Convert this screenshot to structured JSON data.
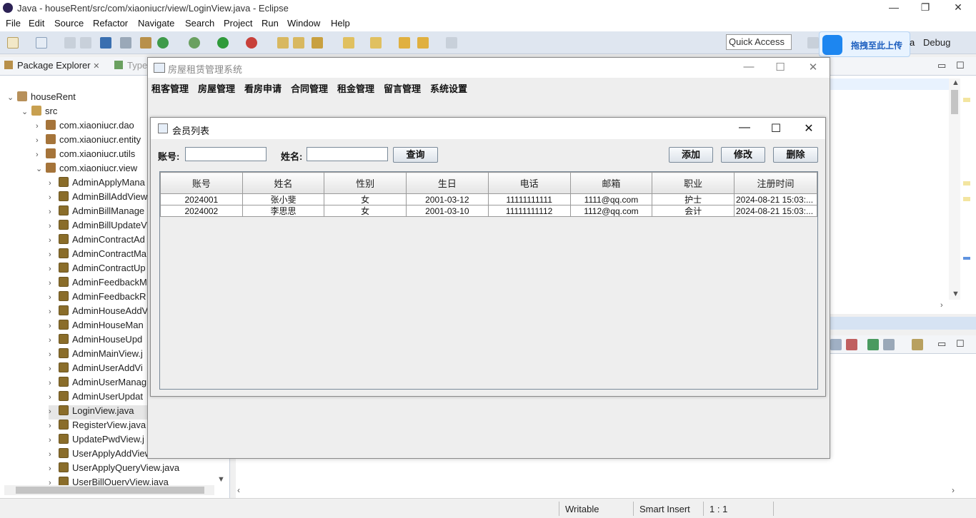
{
  "eclipse": {
    "window_title": "Java - houseRent/src/com/xiaoniucr/view/LoginView.java - Eclipse",
    "menu": [
      "File",
      "Edit",
      "Source",
      "Refactor",
      "Navigate",
      "Search",
      "Project",
      "Run",
      "Window",
      "Help"
    ],
    "quick_access": "Quick Access",
    "upload_label": "拖拽至此上传",
    "debug_label": "Debug",
    "package_explorer_tab": "Package Explorer",
    "type_hierarchy_tab": "Type",
    "tree": [
      {
        "label": "houseRent",
        "icon": "project-icon"
      },
      {
        "label": "src",
        "icon": "source-folder-icon"
      },
      {
        "label": "com.xiaoniucr.dao",
        "icon": "package-icon"
      },
      {
        "label": "com.xiaoniucr.entity",
        "icon": "package-icon"
      },
      {
        "label": "com.xiaoniucr.utils",
        "icon": "package-icon"
      },
      {
        "label": "com.xiaoniucr.view",
        "icon": "package-icon"
      },
      {
        "label": "AdminApplyMana",
        "icon": "java-file-icon"
      },
      {
        "label": "AdminBillAddView",
        "icon": "java-file-icon"
      },
      {
        "label": "AdminBillManage",
        "icon": "java-file-icon"
      },
      {
        "label": "AdminBillUpdateV",
        "icon": "java-file-icon"
      },
      {
        "label": "AdminContractAd",
        "icon": "java-file-icon"
      },
      {
        "label": "AdminContractMa",
        "icon": "java-file-icon"
      },
      {
        "label": "AdminContractUp",
        "icon": "java-file-icon"
      },
      {
        "label": "AdminFeedbackM",
        "icon": "java-file-icon"
      },
      {
        "label": "AdminFeedbackR",
        "icon": "java-file-icon"
      },
      {
        "label": "AdminHouseAddV",
        "icon": "java-file-icon"
      },
      {
        "label": "AdminHouseMan",
        "icon": "java-file-icon"
      },
      {
        "label": "AdminHouseUpd",
        "icon": "java-file-icon"
      },
      {
        "label": "AdminMainView.j",
        "icon": "java-file-icon"
      },
      {
        "label": "AdminUserAddVi",
        "icon": "java-file-icon"
      },
      {
        "label": "AdminUserManag",
        "icon": "java-file-icon"
      },
      {
        "label": "AdminUserUpdat",
        "icon": "java-file-icon"
      },
      {
        "label": "LoginView.java",
        "icon": "java-file-icon"
      },
      {
        "label": "RegisterView.java",
        "icon": "java-file-icon"
      },
      {
        "label": "UpdatePwdView.j",
        "icon": "java-file-icon"
      },
      {
        "label": "UserApplyAddView.java",
        "icon": "java-file-icon"
      },
      {
        "label": "UserApplyQueryView.java",
        "icon": "java-file-icon"
      },
      {
        "label": "UserBillQueryView.java",
        "icon": "java-file-icon"
      }
    ],
    "status": {
      "writable": "Writable",
      "insert_mode": "Smart Insert",
      "position": "1 : 1"
    }
  },
  "app": {
    "title": "房屋租赁管理系统",
    "menu": [
      "租客管理",
      "房屋管理",
      "看房申请",
      "合同管理",
      "租金管理",
      "留言管理",
      "系统设置"
    ]
  },
  "member_list": {
    "title": "会员列表",
    "account_label": "账号:",
    "name_label": "姓名:",
    "account_value": "",
    "name_value": "",
    "query_button": "查询",
    "add_button": "添加",
    "edit_button": "修改",
    "delete_button": "删除",
    "columns": [
      "账号",
      "姓名",
      "性别",
      "生日",
      "电话",
      "邮箱",
      "职业",
      "注册时间"
    ],
    "rows": [
      [
        "2024001",
        "张小斐",
        "女",
        "2001-03-12",
        "11111111111",
        "1111@qq.com",
        "护士",
        "2024-08-21 15:03:..."
      ],
      [
        "2024002",
        "李思思",
        "女",
        "2001-03-10",
        "11111111112",
        "1112@qq.com",
        "会计",
        "2024-08-21 15:03:..."
      ]
    ]
  }
}
